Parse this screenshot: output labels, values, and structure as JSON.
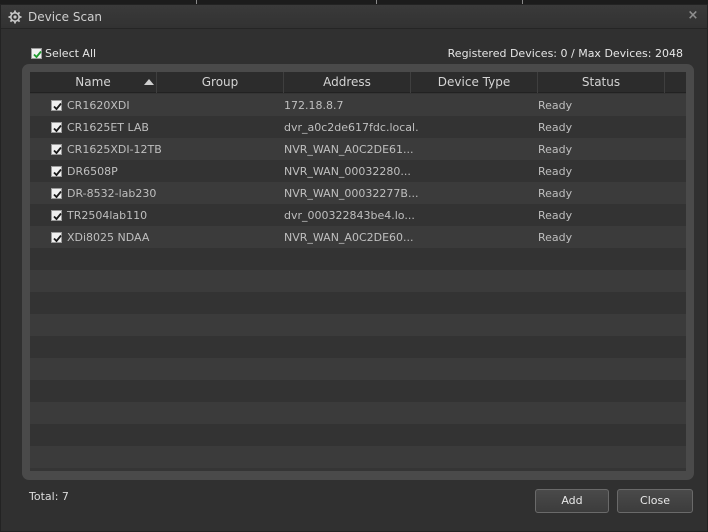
{
  "window": {
    "title": "Device Scan",
    "close_glyph": "×"
  },
  "toolbar": {
    "select_all_label": "Select All",
    "registered_info": "Registered Devices: 0 / Max Devices: 2048"
  },
  "table": {
    "columns": [
      {
        "label": "Name",
        "sort": "ascending"
      },
      {
        "label": "Group"
      },
      {
        "label": "Address"
      },
      {
        "label": "Device Type"
      },
      {
        "label": "Status"
      }
    ],
    "rows": [
      {
        "name": "CR1620XDI",
        "group": "",
        "address": "172.18.8.7",
        "type": "",
        "status": "Ready",
        "checked": true
      },
      {
        "name": "CR1625ET LAB",
        "group": "",
        "address": "dvr_a0c2de617fdc.local.",
        "type": "",
        "status": "Ready",
        "checked": true
      },
      {
        "name": "CR1625XDI-12TB",
        "group": "",
        "address": "NVR_WAN_A0C2DE61...",
        "type": "",
        "status": "Ready",
        "checked": true
      },
      {
        "name": "DR6508P",
        "group": "",
        "address": "NVR_WAN_00032280...",
        "type": "",
        "status": "Ready",
        "checked": true
      },
      {
        "name": "DR-8532-lab230",
        "group": "",
        "address": "NVR_WAN_00032277B...",
        "type": "",
        "status": "Ready",
        "checked": true
      },
      {
        "name": "TR2504lab110",
        "group": "",
        "address": "dvr_000322843be4.lo...",
        "type": "",
        "status": "Ready",
        "checked": true
      },
      {
        "name": "XDi8025 NDAA",
        "group": "",
        "address": "NVR_WAN_A0C2DE60...",
        "type": "",
        "status": "Ready",
        "checked": true
      }
    ]
  },
  "footer": {
    "total_label": "Total: 7",
    "add_label": "Add",
    "close_label": "Close"
  },
  "colors": {
    "window_bg": "#303030",
    "grid_frame": "#4a4a4a",
    "row_odd": "#3b3b3b",
    "row_even": "#333333",
    "checkmark_select_all": "#1e9a2e"
  },
  "icons": {
    "title_icon": "gear-icon",
    "close_icon": "close-icon",
    "sort_icon": "sort-ascending-icon",
    "checkbox_icon": "checkbox-checked-icon"
  }
}
